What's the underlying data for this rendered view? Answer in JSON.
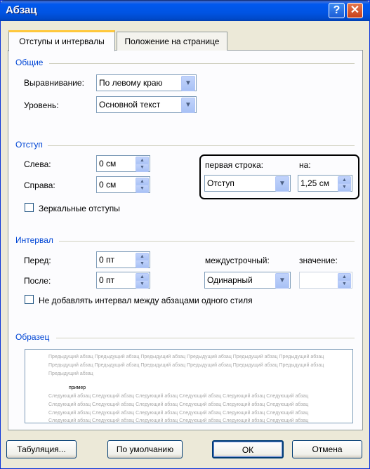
{
  "window": {
    "title": "Абзац",
    "help_glyph": "?",
    "close_glyph": "✕"
  },
  "tabs": [
    {
      "label": "Отступы и интервалы",
      "active": true
    },
    {
      "label": "Положение на странице",
      "active": false
    }
  ],
  "general": {
    "heading": "Общие",
    "alignment_label": "Выравнивание:",
    "alignment_value": "По левому краю",
    "level_label": "Уровень:",
    "level_value": "Основной текст"
  },
  "indent": {
    "heading": "Отступ",
    "left_label": "Слева:",
    "left_value": "0 см",
    "right_label": "Справа:",
    "right_value": "0 см",
    "first_line_label": "первая строка:",
    "first_line_value": "Отступ",
    "by_label": "на:",
    "by_value": "1,25 см",
    "mirror_label": "Зеркальные отступы",
    "mirror_checked": false
  },
  "spacing": {
    "heading": "Интервал",
    "before_label": "Перед:",
    "before_value": "0 пт",
    "after_label": "После:",
    "after_value": "0 пт",
    "line_spacing_label": "междустрочный:",
    "line_spacing_value": "Одинарный",
    "at_label": "значение:",
    "at_value": "",
    "dont_add_label": "Не добавлять интервал между абзацами одного стиля",
    "dont_add_checked": false
  },
  "preview": {
    "heading": "Образец",
    "previous_lines": [
      "Предыдущий абзац Предыдущий абзац Предыдущий абзац Предыдущий абзац Предыдущий абзац Предыдущий абзац",
      "Предыдущий абзац Предыдущий абзац Предыдущий абзац Предыдущий абзац Предыдущий абзац Предыдущий абзац",
      "Предыдущий абзац"
    ],
    "sample_text": "пример",
    "next_lines": [
      "Следующий абзац Следующий абзац Следующий абзац Следующий абзац Следующий абзац Следующий абзац",
      "Следующий абзац Следующий абзац Следующий абзац Следующий абзац Следующий абзац Следующий абзац",
      "Следующий абзац Следующий абзац Следующий абзац Следующий абзац Следующий абзац Следующий абзац",
      "Следующий абзац Следующий абзац Следующий абзац Следующий абзац Следующий абзац Следующий абзац"
    ]
  },
  "buttons": {
    "tabs_label": "Табуляция...",
    "default_label": "По умолчанию",
    "ok_label": "ОК",
    "cancel_label": "Отмена"
  },
  "icons": {
    "dropdown": "chevron-down-icon",
    "spin_up": "arrow-up-icon",
    "spin_down": "arrow-down-icon"
  },
  "colors": {
    "titlebar": "#0054E3",
    "section_heading": "#0046D5",
    "dialog_bg": "#ECE9D8"
  }
}
